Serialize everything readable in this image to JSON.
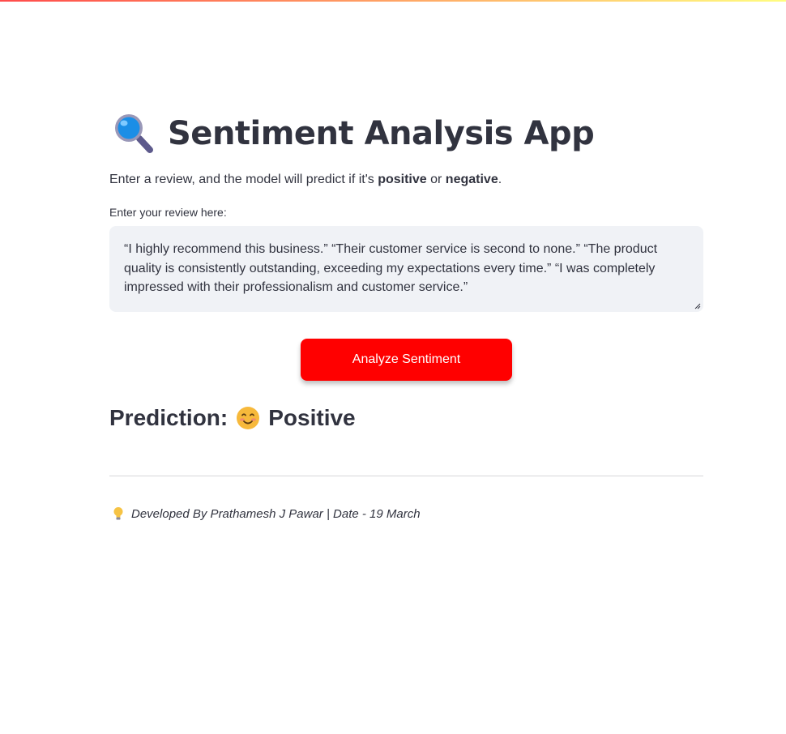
{
  "app": {
    "title": "Sentiment Analysis App",
    "title_icon": "magnifying-glass-icon",
    "subtitle_before": "Enter a review, and the model will predict if it's ",
    "subtitle_positive": "positive",
    "subtitle_or": " or ",
    "subtitle_negative": "negative",
    "subtitle_after": "."
  },
  "review": {
    "label": "Enter your review here:",
    "value": "“I highly recommend this business.” “Their customer service is second to none.” “The product quality is consistently outstanding, exceeding my expectations every time.” “I was completely impressed with their professionalism and customer service.”"
  },
  "button": {
    "label": "Analyze Sentiment"
  },
  "prediction": {
    "prefix": "Prediction:",
    "icon": "smiling-face-icon",
    "label": "Positive"
  },
  "footer": {
    "icon": "lightbulb-icon",
    "text": "Developed By Prathamesh J Pawar | Date - 19 March"
  },
  "colors": {
    "accent": "#ff0000",
    "text": "#31333f",
    "input_bg": "#f0f2f6",
    "divider": "#d6d6d9"
  }
}
